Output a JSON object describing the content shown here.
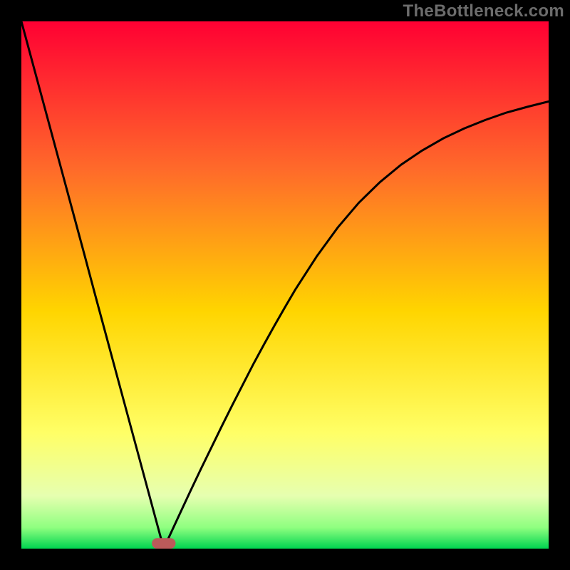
{
  "watermark": "TheBottleneck.com",
  "chart_data": {
    "type": "line",
    "title": "",
    "xlabel": "",
    "ylabel": "",
    "xlim": [
      0,
      100
    ],
    "ylim": [
      0,
      100
    ],
    "x": [
      0,
      2,
      4,
      6,
      8,
      10,
      12,
      14,
      16,
      18,
      20,
      22,
      24,
      26,
      27,
      28,
      30,
      32,
      34,
      36,
      38,
      40,
      42,
      44,
      46,
      48,
      50,
      52,
      56,
      60,
      64,
      68,
      72,
      76,
      80,
      84,
      88,
      92,
      96,
      100
    ],
    "values": [
      100,
      92.6,
      85.2,
      77.8,
      70.4,
      63.0,
      55.6,
      48.1,
      40.7,
      33.3,
      25.9,
      18.5,
      11.1,
      3.7,
      0.0,
      2.2,
      6.5,
      10.8,
      15.0,
      19.1,
      23.2,
      27.2,
      31.1,
      35.0,
      38.7,
      42.3,
      45.8,
      49.2,
      55.4,
      60.9,
      65.6,
      69.5,
      72.8,
      75.5,
      77.8,
      79.7,
      81.3,
      82.7,
      83.8,
      84.8
    ],
    "optimal_x": 27,
    "gradient": {
      "top": "#ff0033",
      "upper_mid": "#ff7f27",
      "mid": "#ffd500",
      "lower_mid": "#ffff66",
      "lower": "#ccff66",
      "bottom": "#00d450"
    },
    "marker": {
      "x": 27,
      "y": 1,
      "shape": "rounded-pill",
      "fill": "#c05a5a",
      "w": 4.5,
      "h": 2.0
    }
  }
}
